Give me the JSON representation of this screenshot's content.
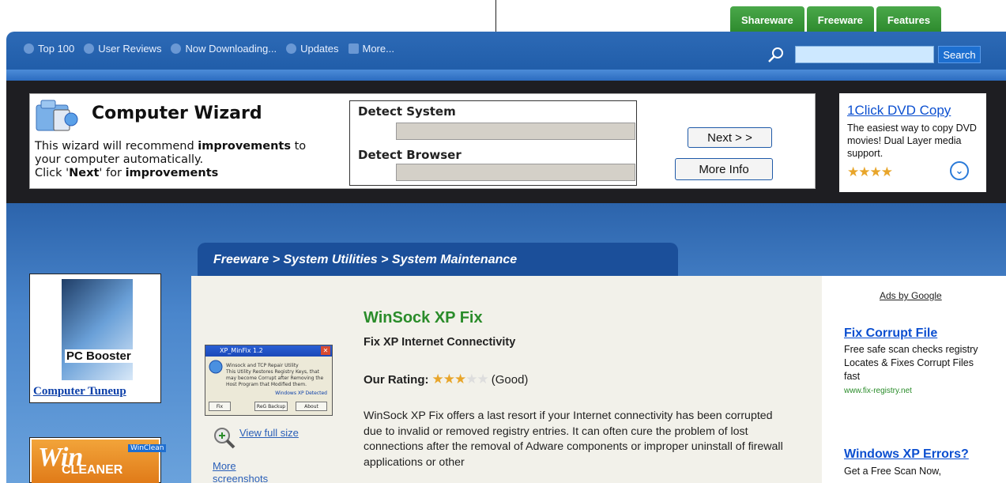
{
  "tabs": [
    "Shareware",
    "Freeware",
    "Features"
  ],
  "nav": [
    "Top 100",
    "User Reviews",
    "Now Downloading...",
    "Updates",
    "More..."
  ],
  "search": {
    "button": "Search",
    "value": ""
  },
  "wizard": {
    "title": "Computer Wizard",
    "line1_pre": "This wizard will recommend ",
    "line1_bold": "improvements",
    "line1_post": " to",
    "line2": "your computer automatically.",
    "line3_pre": "Click '",
    "line3_bold": "Next",
    "line3_mid": "' for ",
    "line3_bold2": "improvements",
    "detect_system": "Detect System",
    "detect_browser": "Detect Browser",
    "next": "Next > >",
    "more_info": "More Info"
  },
  "ad_top": {
    "title": "1Click DVD Copy",
    "desc": "The easiest way to copy DVD movies! Dual Layer media support.",
    "stars": "★★★★",
    "chevron": "⌄"
  },
  "breadcrumb": "Freeware > System Utilities > System Maintenance",
  "left_ads": {
    "product_label": "PC Booster",
    "link": "Computer Tuneup",
    "win_w": "Win",
    "win_cleaner": "CLEANER",
    "win_tag": "WinClean"
  },
  "screenshot": {
    "title": "XP_MinFix 1.2",
    "heading": "Winsock and TCP Repair Utility",
    "text": "This Utility Restores Registry Keys, that may become Corrupt after Removing the Host Program that Modified them.",
    "detected": "Windows XP Detected",
    "btn_fix": "Fix",
    "btn_backup": "ReG Backup",
    "btn_about": "About",
    "view_full": "View full size",
    "more": "More",
    "more2": "screenshots"
  },
  "product": {
    "title": "WinSock XP Fix",
    "subtitle": "Fix XP Internet Connectivity",
    "rating_label": "Our Rating:",
    "rating_stars": "★★★",
    "rating_empty": "★★",
    "rating_value": 3,
    "rating_max": 5,
    "rating_text": "(Good)",
    "description": "WinSock XP Fix offers a last resort if your Internet connectivity has been corrupted due to invalid or removed registry entries. It can often cure the problem of lost connections after the removal of Adware components or improper uninstall of firewall applications or other"
  },
  "google_ads": {
    "label": "Ads by Google",
    "ad1": {
      "title": "Fix Corrupt File",
      "desc": "Free safe scan checks registry Locates & Fixes Corrupt Files fast",
      "url": "www.fix-registry.net"
    },
    "ad2": {
      "title": "Windows XP Errors?",
      "desc": "Get a Free Scan Now,"
    }
  }
}
